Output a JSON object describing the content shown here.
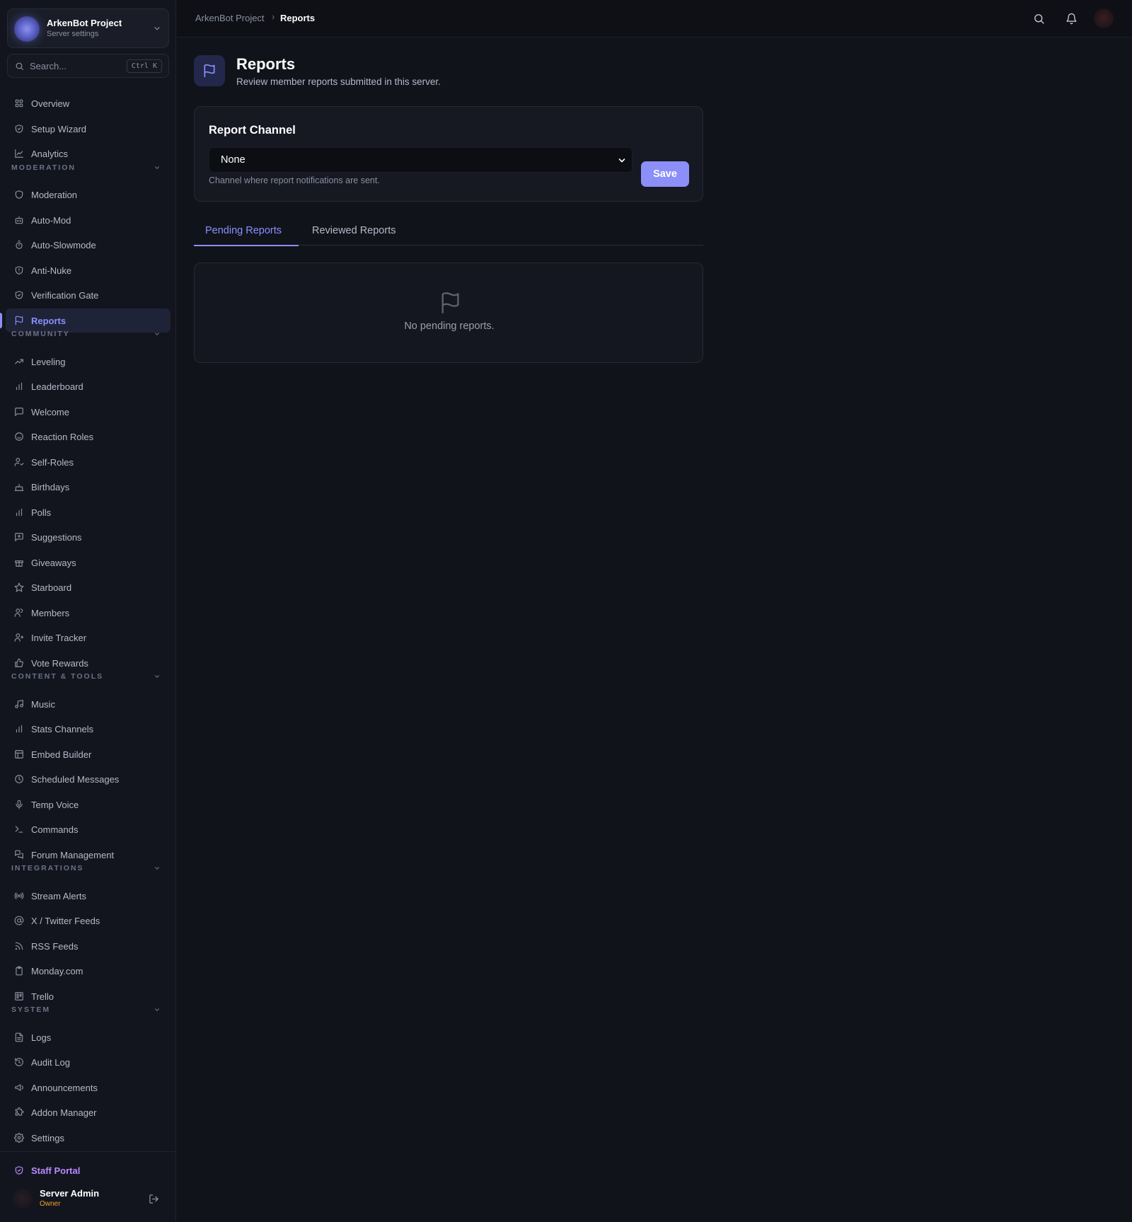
{
  "sidebar": {
    "server": {
      "name": "ArkenBot Project",
      "subtitle": "Server settings"
    },
    "search": {
      "placeholder": "Search...",
      "shortcut": "Ctrl K"
    },
    "top_items": [
      {
        "label": "Overview",
        "icon": "grid-icon"
      },
      {
        "label": "Setup Wizard",
        "icon": "shield-check-icon"
      },
      {
        "label": "Analytics",
        "icon": "chart-line-icon"
      }
    ],
    "sections": [
      {
        "title": "MODERATION",
        "items": [
          {
            "label": "Moderation",
            "icon": "shield-icon"
          },
          {
            "label": "Auto-Mod",
            "icon": "robot-icon"
          },
          {
            "label": "Auto-Slowmode",
            "icon": "timer-icon"
          },
          {
            "label": "Anti-Nuke",
            "icon": "shield-alert-icon"
          },
          {
            "label": "Verification Gate",
            "icon": "shield-check-icon"
          },
          {
            "label": "Reports",
            "icon": "flag-icon",
            "active": true
          }
        ]
      },
      {
        "title": "COMMUNITY",
        "items": [
          {
            "label": "Leveling",
            "icon": "trending-up-icon"
          },
          {
            "label": "Leaderboard",
            "icon": "bar-chart-icon"
          },
          {
            "label": "Welcome",
            "icon": "message-square-icon"
          },
          {
            "label": "Reaction Roles",
            "icon": "smile-icon"
          },
          {
            "label": "Self-Roles",
            "icon": "user-check-icon"
          },
          {
            "label": "Birthdays",
            "icon": "cake-icon"
          },
          {
            "label": "Polls",
            "icon": "bar-chart-icon"
          },
          {
            "label": "Suggestions",
            "icon": "message-plus-icon"
          },
          {
            "label": "Giveaways",
            "icon": "gift-icon"
          },
          {
            "label": "Starboard",
            "icon": "star-icon"
          },
          {
            "label": "Members",
            "icon": "users-icon"
          },
          {
            "label": "Invite Tracker",
            "icon": "user-plus-icon"
          },
          {
            "label": "Vote Rewards",
            "icon": "thumbs-up-icon"
          }
        ]
      },
      {
        "title": "CONTENT & TOOLS",
        "items": [
          {
            "label": "Music",
            "icon": "music-icon"
          },
          {
            "label": "Stats Channels",
            "icon": "bar-chart-icon"
          },
          {
            "label": "Embed Builder",
            "icon": "layout-icon"
          },
          {
            "label": "Scheduled Messages",
            "icon": "clock-icon"
          },
          {
            "label": "Temp Voice",
            "icon": "mic-icon"
          },
          {
            "label": "Commands",
            "icon": "terminal-icon"
          },
          {
            "label": "Forum Management",
            "icon": "messages-icon"
          }
        ]
      },
      {
        "title": "INTEGRATIONS",
        "items": [
          {
            "label": "Stream Alerts",
            "icon": "broadcast-icon"
          },
          {
            "label": "X / Twitter Feeds",
            "icon": "at-sign-icon"
          },
          {
            "label": "RSS Feeds",
            "icon": "rss-icon"
          },
          {
            "label": "Monday.com",
            "icon": "clipboard-icon"
          },
          {
            "label": "Trello",
            "icon": "trello-icon"
          }
        ]
      },
      {
        "title": "SYSTEM",
        "items": [
          {
            "label": "Logs",
            "icon": "file-text-icon"
          },
          {
            "label": "Audit Log",
            "icon": "history-icon"
          },
          {
            "label": "Announcements",
            "icon": "megaphone-icon"
          },
          {
            "label": "Addon Manager",
            "icon": "puzzle-icon"
          },
          {
            "label": "Settings",
            "icon": "gear-icon"
          }
        ]
      }
    ],
    "staff_portal": "Staff Portal",
    "user": {
      "name": "Server Admin",
      "role": "Owner"
    }
  },
  "topbar": {
    "breadcrumb_root": "ArkenBot Project",
    "breadcrumb_sep": "›",
    "breadcrumb_current": "Reports"
  },
  "page": {
    "title": "Reports",
    "subtitle": "Review member reports submitted in this server."
  },
  "report_channel": {
    "title": "Report Channel",
    "selected": "None",
    "help": "Channel where report notifications are sent.",
    "save_label": "Save"
  },
  "tabs": [
    {
      "label": "Pending Reports",
      "active": true
    },
    {
      "label": "Reviewed Reports",
      "active": false
    }
  ],
  "empty_state": {
    "text": "No pending reports."
  },
  "colors": {
    "accent": "#8b8ff7",
    "background": "#11131b",
    "sidebar": "#13151e",
    "owner_badge": "#f0a52a",
    "staff_portal": "#b78bff"
  }
}
